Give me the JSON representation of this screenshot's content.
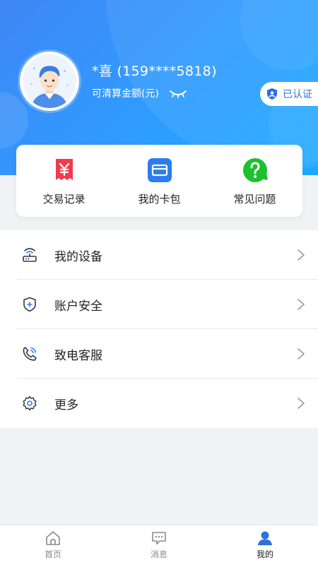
{
  "profile": {
    "name": "*喜 (159****5818)",
    "balance_label": "可清算金额(元)",
    "verified_label": "已认证"
  },
  "quick_actions": [
    {
      "label": "交易记录",
      "icon": "yuan-receipt-icon",
      "color": "#f23a50"
    },
    {
      "label": "我的卡包",
      "icon": "card-wallet-icon",
      "color": "#2a7cf0"
    },
    {
      "label": "常见问题",
      "icon": "question-icon",
      "color": "#1bc12e"
    }
  ],
  "menu": [
    {
      "label": "我的设备",
      "icon": "router-icon"
    },
    {
      "label": "账户安全",
      "icon": "shield-icon"
    },
    {
      "label": "致电客服",
      "icon": "phone-icon"
    },
    {
      "label": "更多",
      "icon": "gear-icon"
    }
  ],
  "tabbar": {
    "items": [
      {
        "label": "首页",
        "icon": "home-icon"
      },
      {
        "label": "消息",
        "icon": "message-icon"
      },
      {
        "label": "我的",
        "icon": "user-icon"
      }
    ],
    "active": "我的"
  },
  "colors": {
    "header_gradient_start": "#3f87f5",
    "header_gradient_end": "#1aa9ff",
    "accent": "#2f6fe0"
  }
}
